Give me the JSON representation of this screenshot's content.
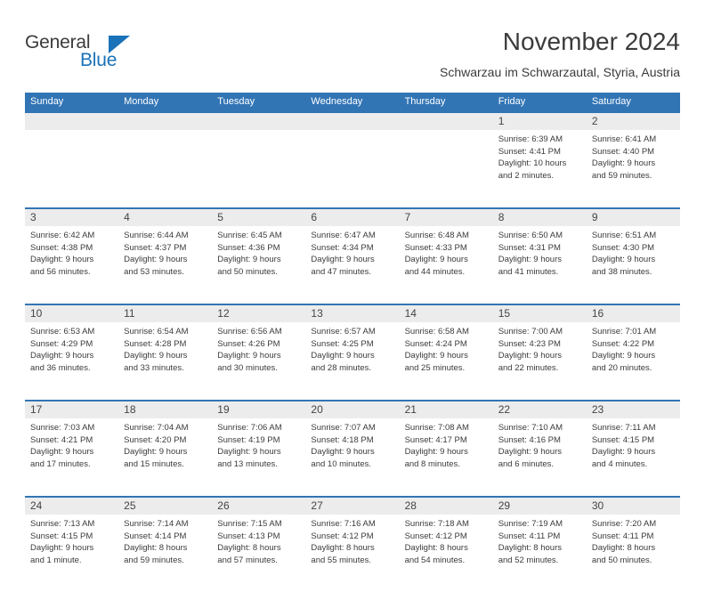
{
  "brand": {
    "name_part1": "General",
    "name_part2": "Blue",
    "accent_color": "#1a72b8"
  },
  "header": {
    "title": "November 2024",
    "location": "Schwarzau im Schwarzautal, Styria, Austria",
    "header_bar_color": "#3275b5",
    "daynum_band_color": "#ececec"
  },
  "weekdays": [
    "Sunday",
    "Monday",
    "Tuesday",
    "Wednesday",
    "Thursday",
    "Friday",
    "Saturday"
  ],
  "weeks": [
    [
      {
        "day": "",
        "sunrise": "",
        "sunset": "",
        "daylight1": "",
        "daylight2": ""
      },
      {
        "day": "",
        "sunrise": "",
        "sunset": "",
        "daylight1": "",
        "daylight2": ""
      },
      {
        "day": "",
        "sunrise": "",
        "sunset": "",
        "daylight1": "",
        "daylight2": ""
      },
      {
        "day": "",
        "sunrise": "",
        "sunset": "",
        "daylight1": "",
        "daylight2": ""
      },
      {
        "day": "",
        "sunrise": "",
        "sunset": "",
        "daylight1": "",
        "daylight2": ""
      },
      {
        "day": "1",
        "sunrise": "Sunrise: 6:39 AM",
        "sunset": "Sunset: 4:41 PM",
        "daylight1": "Daylight: 10 hours",
        "daylight2": "and 2 minutes."
      },
      {
        "day": "2",
        "sunrise": "Sunrise: 6:41 AM",
        "sunset": "Sunset: 4:40 PM",
        "daylight1": "Daylight: 9 hours",
        "daylight2": "and 59 minutes."
      }
    ],
    [
      {
        "day": "3",
        "sunrise": "Sunrise: 6:42 AM",
        "sunset": "Sunset: 4:38 PM",
        "daylight1": "Daylight: 9 hours",
        "daylight2": "and 56 minutes."
      },
      {
        "day": "4",
        "sunrise": "Sunrise: 6:44 AM",
        "sunset": "Sunset: 4:37 PM",
        "daylight1": "Daylight: 9 hours",
        "daylight2": "and 53 minutes."
      },
      {
        "day": "5",
        "sunrise": "Sunrise: 6:45 AM",
        "sunset": "Sunset: 4:36 PM",
        "daylight1": "Daylight: 9 hours",
        "daylight2": "and 50 minutes."
      },
      {
        "day": "6",
        "sunrise": "Sunrise: 6:47 AM",
        "sunset": "Sunset: 4:34 PM",
        "daylight1": "Daylight: 9 hours",
        "daylight2": "and 47 minutes."
      },
      {
        "day": "7",
        "sunrise": "Sunrise: 6:48 AM",
        "sunset": "Sunset: 4:33 PM",
        "daylight1": "Daylight: 9 hours",
        "daylight2": "and 44 minutes."
      },
      {
        "day": "8",
        "sunrise": "Sunrise: 6:50 AM",
        "sunset": "Sunset: 4:31 PM",
        "daylight1": "Daylight: 9 hours",
        "daylight2": "and 41 minutes."
      },
      {
        "day": "9",
        "sunrise": "Sunrise: 6:51 AM",
        "sunset": "Sunset: 4:30 PM",
        "daylight1": "Daylight: 9 hours",
        "daylight2": "and 38 minutes."
      }
    ],
    [
      {
        "day": "10",
        "sunrise": "Sunrise: 6:53 AM",
        "sunset": "Sunset: 4:29 PM",
        "daylight1": "Daylight: 9 hours",
        "daylight2": "and 36 minutes."
      },
      {
        "day": "11",
        "sunrise": "Sunrise: 6:54 AM",
        "sunset": "Sunset: 4:28 PM",
        "daylight1": "Daylight: 9 hours",
        "daylight2": "and 33 minutes."
      },
      {
        "day": "12",
        "sunrise": "Sunrise: 6:56 AM",
        "sunset": "Sunset: 4:26 PM",
        "daylight1": "Daylight: 9 hours",
        "daylight2": "and 30 minutes."
      },
      {
        "day": "13",
        "sunrise": "Sunrise: 6:57 AM",
        "sunset": "Sunset: 4:25 PM",
        "daylight1": "Daylight: 9 hours",
        "daylight2": "and 28 minutes."
      },
      {
        "day": "14",
        "sunrise": "Sunrise: 6:58 AM",
        "sunset": "Sunset: 4:24 PM",
        "daylight1": "Daylight: 9 hours",
        "daylight2": "and 25 minutes."
      },
      {
        "day": "15",
        "sunrise": "Sunrise: 7:00 AM",
        "sunset": "Sunset: 4:23 PM",
        "daylight1": "Daylight: 9 hours",
        "daylight2": "and 22 minutes."
      },
      {
        "day": "16",
        "sunrise": "Sunrise: 7:01 AM",
        "sunset": "Sunset: 4:22 PM",
        "daylight1": "Daylight: 9 hours",
        "daylight2": "and 20 minutes."
      }
    ],
    [
      {
        "day": "17",
        "sunrise": "Sunrise: 7:03 AM",
        "sunset": "Sunset: 4:21 PM",
        "daylight1": "Daylight: 9 hours",
        "daylight2": "and 17 minutes."
      },
      {
        "day": "18",
        "sunrise": "Sunrise: 7:04 AM",
        "sunset": "Sunset: 4:20 PM",
        "daylight1": "Daylight: 9 hours",
        "daylight2": "and 15 minutes."
      },
      {
        "day": "19",
        "sunrise": "Sunrise: 7:06 AM",
        "sunset": "Sunset: 4:19 PM",
        "daylight1": "Daylight: 9 hours",
        "daylight2": "and 13 minutes."
      },
      {
        "day": "20",
        "sunrise": "Sunrise: 7:07 AM",
        "sunset": "Sunset: 4:18 PM",
        "daylight1": "Daylight: 9 hours",
        "daylight2": "and 10 minutes."
      },
      {
        "day": "21",
        "sunrise": "Sunrise: 7:08 AM",
        "sunset": "Sunset: 4:17 PM",
        "daylight1": "Daylight: 9 hours",
        "daylight2": "and 8 minutes."
      },
      {
        "day": "22",
        "sunrise": "Sunrise: 7:10 AM",
        "sunset": "Sunset: 4:16 PM",
        "daylight1": "Daylight: 9 hours",
        "daylight2": "and 6 minutes."
      },
      {
        "day": "23",
        "sunrise": "Sunrise: 7:11 AM",
        "sunset": "Sunset: 4:15 PM",
        "daylight1": "Daylight: 9 hours",
        "daylight2": "and 4 minutes."
      }
    ],
    [
      {
        "day": "24",
        "sunrise": "Sunrise: 7:13 AM",
        "sunset": "Sunset: 4:15 PM",
        "daylight1": "Daylight: 9 hours",
        "daylight2": "and 1 minute."
      },
      {
        "day": "25",
        "sunrise": "Sunrise: 7:14 AM",
        "sunset": "Sunset: 4:14 PM",
        "daylight1": "Daylight: 8 hours",
        "daylight2": "and 59 minutes."
      },
      {
        "day": "26",
        "sunrise": "Sunrise: 7:15 AM",
        "sunset": "Sunset: 4:13 PM",
        "daylight1": "Daylight: 8 hours",
        "daylight2": "and 57 minutes."
      },
      {
        "day": "27",
        "sunrise": "Sunrise: 7:16 AM",
        "sunset": "Sunset: 4:12 PM",
        "daylight1": "Daylight: 8 hours",
        "daylight2": "and 55 minutes."
      },
      {
        "day": "28",
        "sunrise": "Sunrise: 7:18 AM",
        "sunset": "Sunset: 4:12 PM",
        "daylight1": "Daylight: 8 hours",
        "daylight2": "and 54 minutes."
      },
      {
        "day": "29",
        "sunrise": "Sunrise: 7:19 AM",
        "sunset": "Sunset: 4:11 PM",
        "daylight1": "Daylight: 8 hours",
        "daylight2": "and 52 minutes."
      },
      {
        "day": "30",
        "sunrise": "Sunrise: 7:20 AM",
        "sunset": "Sunset: 4:11 PM",
        "daylight1": "Daylight: 8 hours",
        "daylight2": "and 50 minutes."
      }
    ]
  ]
}
